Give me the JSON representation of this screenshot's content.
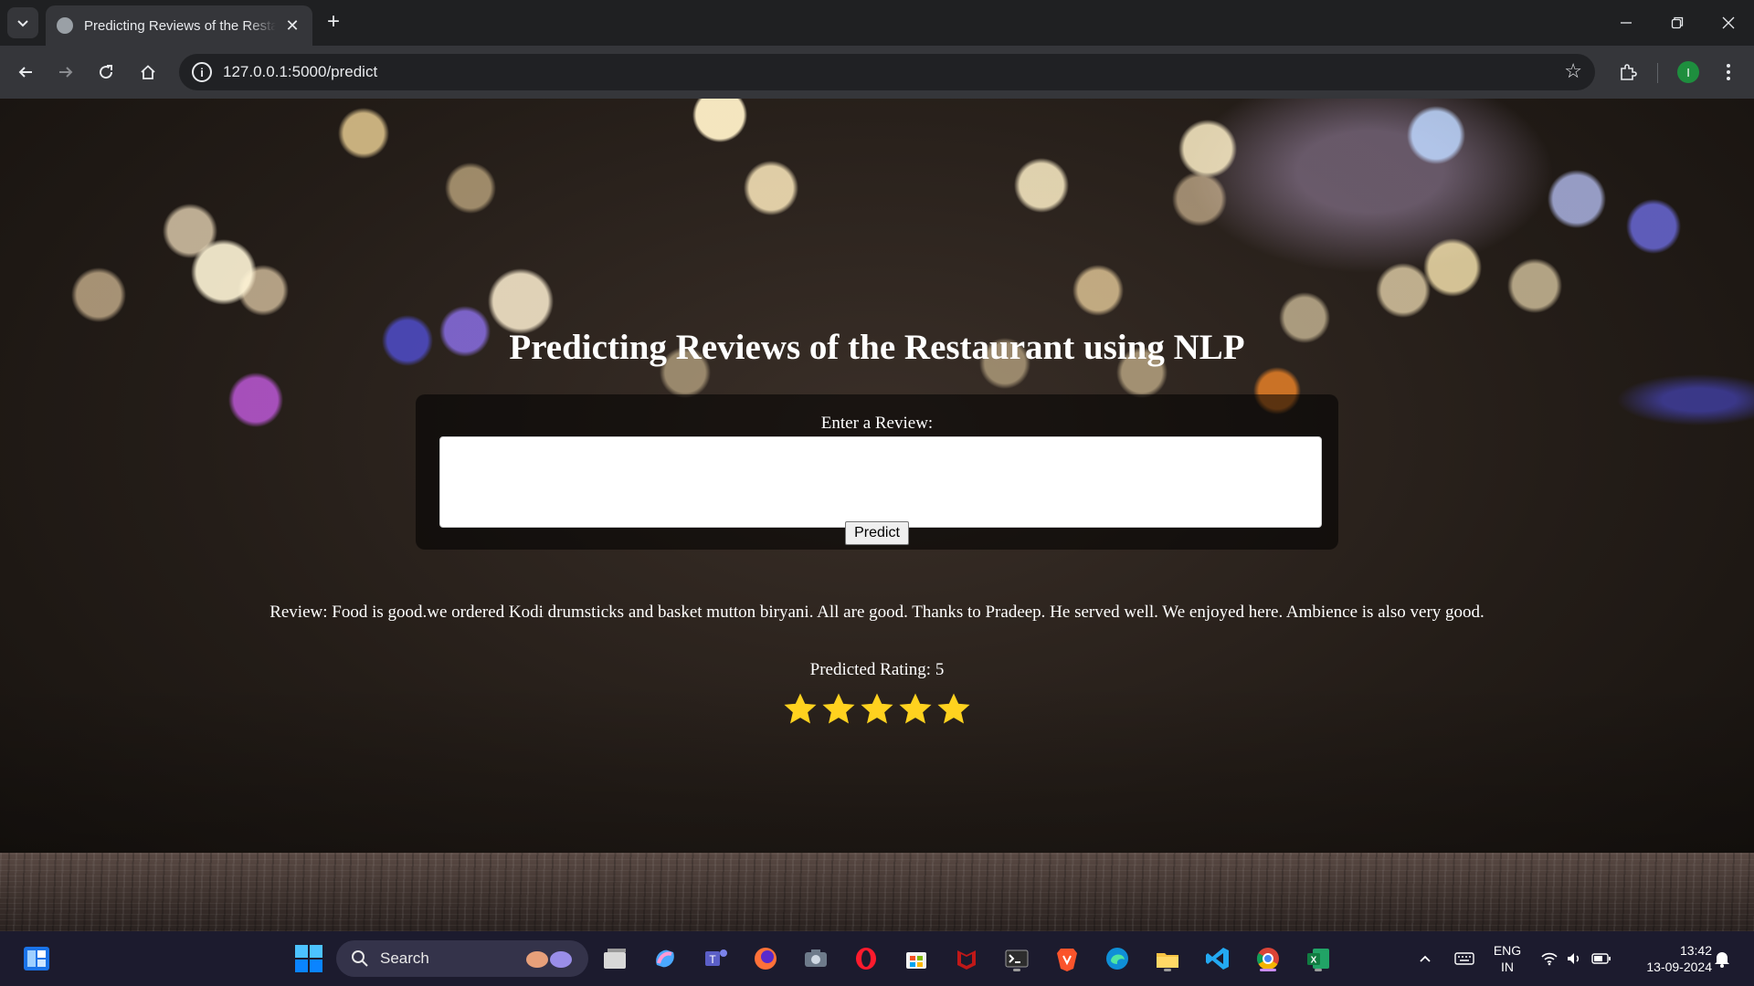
{
  "browser": {
    "tab_title": "Predicting Reviews of the Restaurant using NLP",
    "url": "127.0.0.1:5000/predict",
    "profile_initial": "I",
    "colors": {
      "frame": "#1f2022",
      "toolbar": "#35363a",
      "omnibox": "#202124",
      "profile": "#1e8e3e"
    }
  },
  "page": {
    "title": "Predicting Reviews of the Restaurant using NLP",
    "form": {
      "label": "Enter a Review:",
      "input_value": "",
      "button_label": "Predict"
    },
    "result": {
      "review_text": "Review: Food is good.we ordered Kodi drumsticks and basket mutton biryani. All are good. Thanks to Pradeep. He served well. We enjoyed here. Ambience is also very good.",
      "rating_text": "Predicted Rating: 5",
      "stars_filled": 5,
      "stars_total": 5,
      "star_color": "#ffd21f"
    }
  },
  "taskbar": {
    "search_label": "Search",
    "language": {
      "line1": "ENG",
      "line2": "IN"
    },
    "clock": {
      "time": "13:42",
      "date": "13-09-2024"
    },
    "apps": [
      "widgets-icon",
      "start-icon",
      "task-view-icon",
      "copilot-icon",
      "teams-icon",
      "firefox-icon",
      "camera-icon",
      "opera-icon",
      "store-icon",
      "mcafee-icon",
      "terminal-icon",
      "brave-icon",
      "edge-icon",
      "file-explorer-icon",
      "vscode-icon",
      "chrome-icon",
      "excel-icon"
    ],
    "background": "#1c1b2e"
  }
}
